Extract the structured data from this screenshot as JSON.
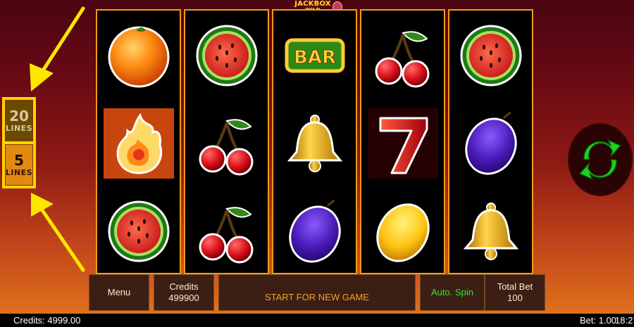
{
  "logo": {
    "line1": "JACKBOX",
    "line2": "WILD"
  },
  "lines_selector": {
    "options": [
      {
        "number": "20",
        "word": "LINES",
        "state": "inactive"
      },
      {
        "number": "5",
        "word": "LINES",
        "state": "active"
      }
    ]
  },
  "reels": [
    [
      "orange-icon",
      "fire-ball-icon",
      "watermelon-icon"
    ],
    [
      "watermelon-icon",
      "cherries-icon",
      "cherries-icon"
    ],
    [
      "bar-icon",
      "bell-icon",
      "plum-icon"
    ],
    [
      "cherries-icon",
      "seven-icon",
      "lemon-icon"
    ],
    [
      "watermelon-icon",
      "plum-icon",
      "bell-icon"
    ]
  ],
  "bar_symbol_text": "BAR",
  "bottom_bar": {
    "menu_label": "Menu",
    "credits_label": "Credits",
    "credits_value": "499900",
    "start_label": "START FOR NEW GAME",
    "auto_spin_label": "Auto. Spin",
    "total_bet_label": "Total Bet",
    "total_bet_value": "100"
  },
  "status_bar": {
    "credits": "Credits: 4999.00",
    "bet": "Bet: 1.00",
    "time": "18:27"
  },
  "colors": {
    "reel_border": "#f19a1a",
    "lines_box": "#ffd400",
    "spin_arrows": "#1fd21f",
    "auto_spin_text": "#34e434",
    "start_text": "#f2a02a"
  }
}
